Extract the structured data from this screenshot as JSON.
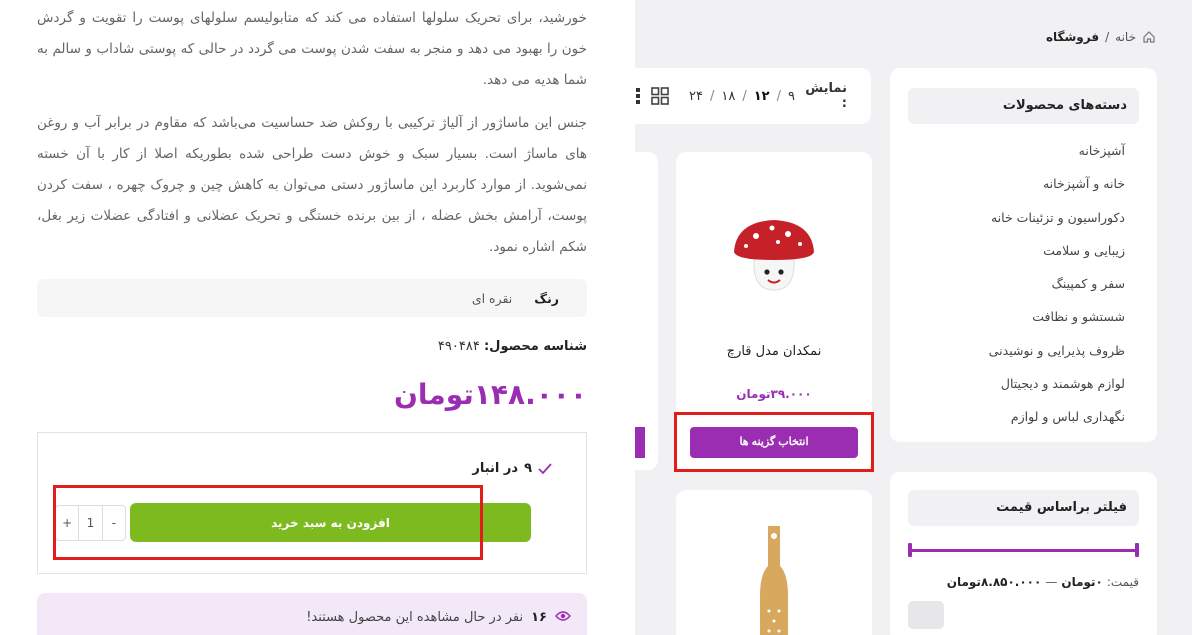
{
  "breadcrumb": {
    "home": "خانه",
    "separator": "/",
    "current": "فروشگاه"
  },
  "categories": {
    "title": "دسته‌های محصولات",
    "items": [
      "آشپزخانه",
      "خانه و آشپزخانه",
      "دکوراسیون و تزئینات خانه",
      "زیبایی و سلامت",
      "سفر و کمپینگ",
      "شستشو و نظافت",
      "ظروف پذیرایی و نوشیدنی",
      "لوازم هوشمند و دیجیتال",
      "نگهداری لباس و لوازم"
    ]
  },
  "price_filter": {
    "title": "فیلتر براساس قیمت",
    "label": "قیمت:",
    "min": "۰تومان",
    "dash": "—",
    "max": "۸.۸۵۰.۰۰۰تومان"
  },
  "display": {
    "label": "نمایش :",
    "options": [
      "۹",
      "۱۲",
      "۱۸",
      "۲۴"
    ],
    "selected": "۱۲",
    "separator": "/"
  },
  "product_card": {
    "name": "نمکدان مدل قارچ",
    "price": "۳۹.۰۰۰تومان",
    "button": "انتخاب گزینه ها"
  },
  "panel": {
    "description": [
      "خورشید، برای تحریک سلولها استفاده می کند که متابولیسم سلولهای پوست را تقویت و گردش خون را بهبود می دهد و منجر به سفت شدن پوست می گردد در حالی که پوستی شاداب و سالم به شما هدیه می دهد.",
      "جنس این ماساژور از آلیاژ ترکیبی با روکش ضد حساسیت می‌باشد که مقاوم در برابر آب و روغن های ماساژ است. بسیار سبک و خوش دست طراحی شده بطوریکه اصلا از کار با آن خسته نمی‌شوید. از موارد کاربرد این ماساژور دستی می‌توان به کاهش چین و چروک چهره ، سفت کردن پوست، آرامش بخش عضله ، از بین برنده خستگی و تحریک عضلانی و افتادگی عضلات زیر بغل، شکم اشاره نمود."
    ],
    "attribute": {
      "key": "رنگ",
      "value": "نقره ای"
    },
    "sku_label": "شناسه محصول:",
    "sku_value": "۴۹۰۴۸۴",
    "price": "۱۴۸.۰۰۰تومان",
    "stock_count": "۹",
    "stock_label": "در انبار",
    "qty_minus": "-",
    "qty_value": "1",
    "qty_plus": "+",
    "add_to_cart": "افزودن به سبد خرید",
    "viewers_count": "۱۶",
    "viewers_text": "نفر در حال مشاهده این محصول هستند!"
  },
  "colors": {
    "accent": "#9b2db3",
    "cart": "#7dba1f",
    "highlight": "#e21b1b"
  }
}
